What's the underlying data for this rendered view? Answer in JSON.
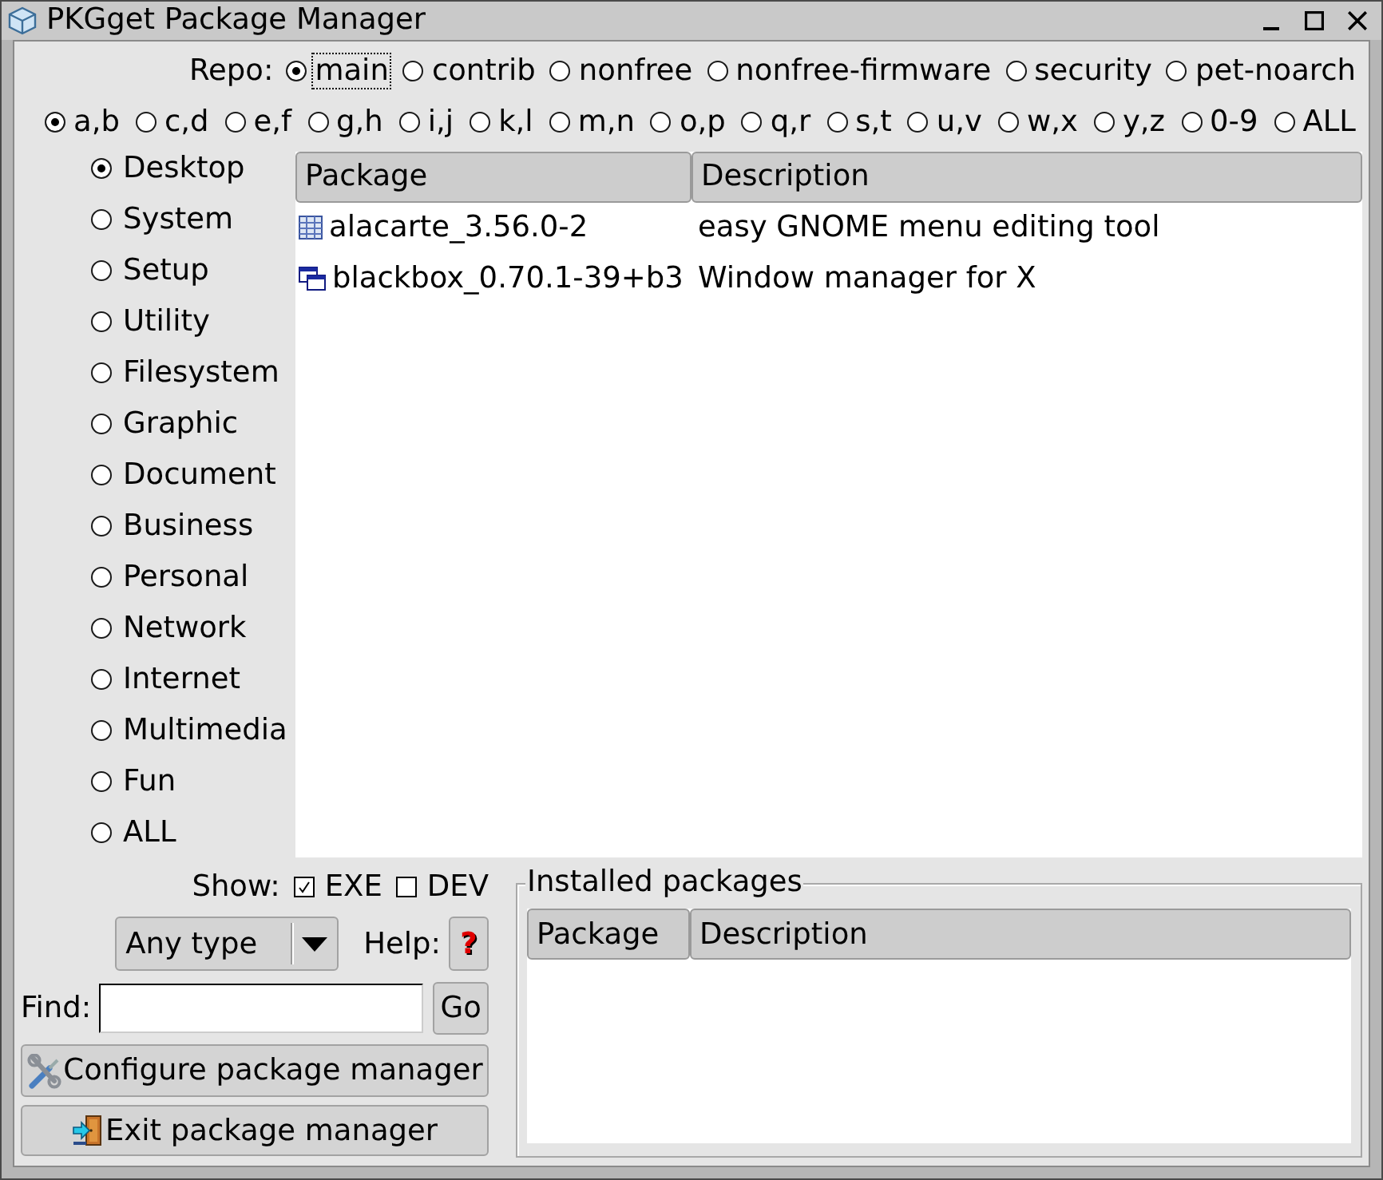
{
  "window": {
    "title": "PKGget Package Manager"
  },
  "repo": {
    "label": "Repo:",
    "options": [
      {
        "label": "main",
        "selected": true,
        "focused": true
      },
      {
        "label": "contrib",
        "selected": false,
        "focused": false
      },
      {
        "label": "nonfree",
        "selected": false,
        "focused": false
      },
      {
        "label": "nonfree-firmware",
        "selected": false,
        "focused": false
      },
      {
        "label": "security",
        "selected": false,
        "focused": false
      },
      {
        "label": "pet-noarch",
        "selected": false,
        "focused": false
      }
    ]
  },
  "letters": [
    {
      "label": "a,b",
      "selected": true
    },
    {
      "label": "c,d",
      "selected": false
    },
    {
      "label": "e,f",
      "selected": false
    },
    {
      "label": "g,h",
      "selected": false
    },
    {
      "label": "i,j",
      "selected": false
    },
    {
      "label": "k,l",
      "selected": false
    },
    {
      "label": "m,n",
      "selected": false
    },
    {
      "label": "o,p",
      "selected": false
    },
    {
      "label": "q,r",
      "selected": false
    },
    {
      "label": "s,t",
      "selected": false
    },
    {
      "label": "u,v",
      "selected": false
    },
    {
      "label": "w,x",
      "selected": false
    },
    {
      "label": "y,z",
      "selected": false
    },
    {
      "label": "0-9",
      "selected": false
    },
    {
      "label": "ALL",
      "selected": false
    }
  ],
  "categories": [
    {
      "label": "Desktop",
      "selected": true
    },
    {
      "label": "System",
      "selected": false
    },
    {
      "label": "Setup",
      "selected": false
    },
    {
      "label": "Utility",
      "selected": false
    },
    {
      "label": "Filesystem",
      "selected": false
    },
    {
      "label": "Graphic",
      "selected": false
    },
    {
      "label": "Document",
      "selected": false
    },
    {
      "label": "Business",
      "selected": false
    },
    {
      "label": "Personal",
      "selected": false
    },
    {
      "label": "Network",
      "selected": false
    },
    {
      "label": "Internet",
      "selected": false
    },
    {
      "label": "Multimedia",
      "selected": false
    },
    {
      "label": "Fun",
      "selected": false
    },
    {
      "label": "ALL",
      "selected": false
    }
  ],
  "packages": {
    "columns": [
      "Package",
      "Description"
    ],
    "rows": [
      {
        "kind": "grid",
        "package": "alacarte_3.56.0-2",
        "description": "easy GNOME menu editing tool"
      },
      {
        "kind": "windows",
        "package": "blackbox_0.70.1-39+b3",
        "description": "Window manager for X"
      }
    ]
  },
  "show": {
    "label": "Show:",
    "options": [
      {
        "label": "EXE",
        "checked": true
      },
      {
        "label": "DEV",
        "checked": false
      }
    ]
  },
  "type_select": {
    "value": "Any type"
  },
  "help": {
    "label": "Help:",
    "button": "?"
  },
  "find": {
    "label": "Find:",
    "button": "Go"
  },
  "actions": [
    {
      "kind": "configure",
      "label": "Configure package manager"
    },
    {
      "kind": "exit",
      "label": "Exit package manager"
    }
  ],
  "installed": {
    "title": "Installed packages",
    "columns": [
      "Package",
      "Description"
    ]
  }
}
